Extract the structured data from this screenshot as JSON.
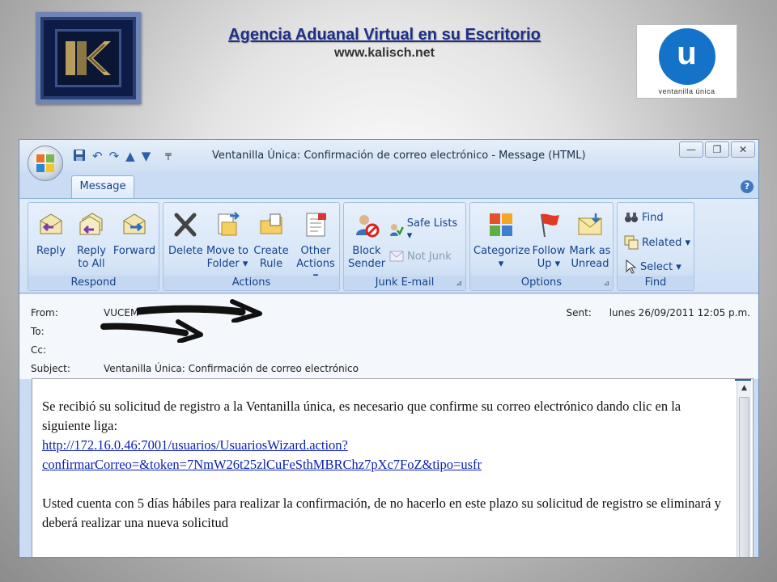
{
  "slide": {
    "title": "Agencia Aduanal Virtual en su Escritorio",
    "url": "www.kalisch.net",
    "logo_right_letter": "u",
    "logo_right_caption": "ventanilla única"
  },
  "window": {
    "title": "Ventanilla Única: Confirmación de correo electrónico - Message (HTML)",
    "controls": [
      "minimize",
      "restore",
      "close"
    ],
    "tab": "Message"
  },
  "ribbon": {
    "groups": [
      {
        "label": "Respond",
        "buttons": [
          {
            "l1": "Reply",
            "l2": ""
          },
          {
            "l1": "Reply",
            "l2": "to All"
          },
          {
            "l1": "Forward",
            "l2": ""
          }
        ]
      },
      {
        "label": "Actions",
        "buttons": [
          {
            "l1": "Delete",
            "l2": ""
          },
          {
            "l1": "Move to",
            "l2": "Folder ▾"
          },
          {
            "l1": "Create",
            "l2": "Rule"
          },
          {
            "l1": "Other",
            "l2": "Actions ▾"
          }
        ]
      },
      {
        "label": "Junk E-mail",
        "big": {
          "l1": "Block",
          "l2": "Sender"
        },
        "small": [
          {
            "label": "Safe Lists ▾"
          },
          {
            "label": "Not Junk"
          }
        ]
      },
      {
        "label": "Options",
        "buttons": [
          {
            "l1": "Categorize",
            "l2": "▾"
          },
          {
            "l1": "Follow",
            "l2": "Up ▾"
          },
          {
            "l1": "Mark as",
            "l2": "Unread"
          }
        ]
      },
      {
        "label": "Find",
        "small": [
          {
            "label": "Find"
          },
          {
            "label": "Related ▾"
          },
          {
            "label": "Select ▾"
          }
        ]
      }
    ]
  },
  "message": {
    "from_label": "From:",
    "from_value": "VUCEM",
    "to_label": "To:",
    "cc_label": "Cc:",
    "subject_label": "Subject:",
    "subject_value": "Ventanilla Única: Confirmación de correo electrónico",
    "sent_label": "Sent:",
    "sent_value": "lunes 26/09/2011 12:05 p.m.",
    "body_p1": "Se recibió su solicitud de registro a la Ventanilla única, es necesario que confirme su correo electrónico dando clic en la siguiente liga:",
    "link_line1": "http://172.16.0.46:7001/usuarios/UsuariosWizard.action?",
    "link_line2": "confirmarCorreo=&token=7NmW26t25zlCuFeSthMBRChz7pXc7FoZ&tipo=usfr",
    "body_p2": "Usted cuenta con 5 días hábiles para realizar la confirmación, de no hacerlo en este plazo su solicitud de registro se eliminará y deberá realizar una nueva solicitud"
  },
  "colors": {
    "title_blue": "#1d2f86",
    "ribbon_text": "#15428b",
    "link": "#0a1fb3",
    "vu_blue": "#1473c9"
  }
}
